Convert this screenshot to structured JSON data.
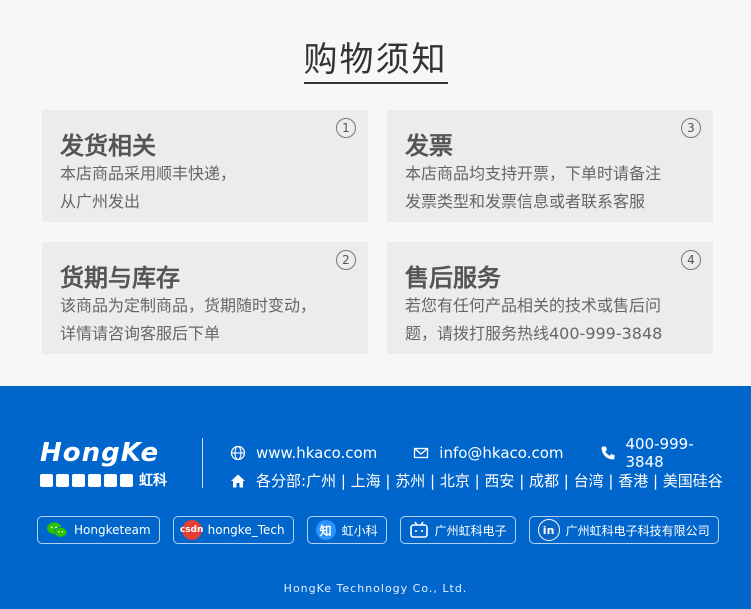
{
  "title": "购物须知",
  "cards": [
    {
      "title": "发货相关",
      "num": "1",
      "line1": "本店商品采用顺丰快递，",
      "line2": "从广州发出"
    },
    {
      "title": "发票",
      "num": "3",
      "line1": "本店商品均支持开票，下单时请备注",
      "line2": "发票类型和发票信息或者联系客服"
    },
    {
      "title": "货期与库存",
      "num": "2",
      "line1": "该商品为定制商品，货期随时变动，",
      "line2": "详情请咨询客服后下单"
    },
    {
      "title": "售后服务",
      "num": "4",
      "line1": "若您有任何产品相关的技术或售后问",
      "line2": "题，请拨打服务热线400-999-3848"
    }
  ],
  "footer": {
    "logo_name": "HongKe",
    "logo_cn": "虹科",
    "website": "www.hkaco.com",
    "email": "info@hkaco.com",
    "phone": "400-999-3848",
    "branches_label": "各分部:",
    "branches": "广州 | 上海 | 苏州 | 北京 | 西安 | 成都 | 台湾 | 香港 | 美国硅谷",
    "social": [
      {
        "label": "Hongketeam",
        "icon": "wechat-icon"
      },
      {
        "label": "hongke_Tech",
        "icon": "csdn-icon",
        "icon_text": "csdn"
      },
      {
        "label": "虹小科",
        "icon": "zhihu-icon",
        "icon_text": "知"
      },
      {
        "label": "广州虹科电子",
        "icon": "bilibili-icon"
      },
      {
        "label": "广州虹科电子科技有限公司",
        "icon": "linkedin-icon",
        "icon_text": "in"
      }
    ],
    "copyright": "HongKe Technology Co., Ltd."
  },
  "colors": {
    "footer_bg": "#0066cc",
    "card_bg": "#ececec"
  }
}
